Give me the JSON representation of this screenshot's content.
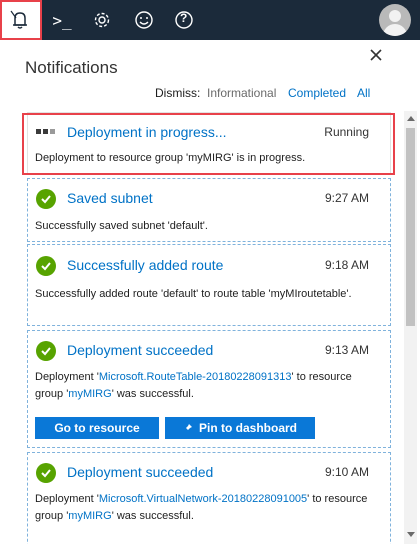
{
  "topbar": {
    "icons": [
      "bell-icon",
      "cloud-shell-icon",
      "gear-icon",
      "smiley-icon",
      "help-icon"
    ],
    "cloud_shell_glyph": ">_",
    "help_glyph": "?"
  },
  "panel": {
    "title": "Notifications",
    "dismiss": {
      "label": "Dismiss:",
      "informational": "Informational",
      "completed": "Completed",
      "all": "All"
    }
  },
  "notifications": [
    {
      "title": "Deployment in progress...",
      "status": "Running",
      "message": "Deployment to resource group 'myMIRG' is in progress."
    },
    {
      "title": "Saved subnet",
      "time": "9:27 AM",
      "message": "Successfully saved subnet 'default'."
    },
    {
      "title": "Successfully added route",
      "time": "9:18 AM",
      "message": "Successfully added route 'default' to route table 'myMIroutetable'."
    },
    {
      "title": "Deployment succeeded",
      "time": "9:13 AM",
      "msg_prefix": "Deployment '",
      "msg_link": "Microsoft.RouteTable-20180228091313",
      "msg_mid": "' to resource group '",
      "msg_rg": "myMIRG",
      "msg_suffix": "' was successful.",
      "go_to_resource": "Go to resource",
      "pin_to_dashboard": "Pin to dashboard"
    },
    {
      "title": "Deployment succeeded",
      "time": "9:10 AM",
      "msg_prefix": "Deployment '",
      "msg_link": "Microsoft.VirtualNetwork-20180228091005",
      "msg_mid": "' to resource group '",
      "msg_rg": "myMIRG",
      "msg_suffix": "' was successful."
    }
  ],
  "colors": {
    "topbar": "#1b2a3a",
    "accent": "#0072c6",
    "success": "#57a300",
    "button": "#0a78d7",
    "highlight": "#e8414a"
  }
}
